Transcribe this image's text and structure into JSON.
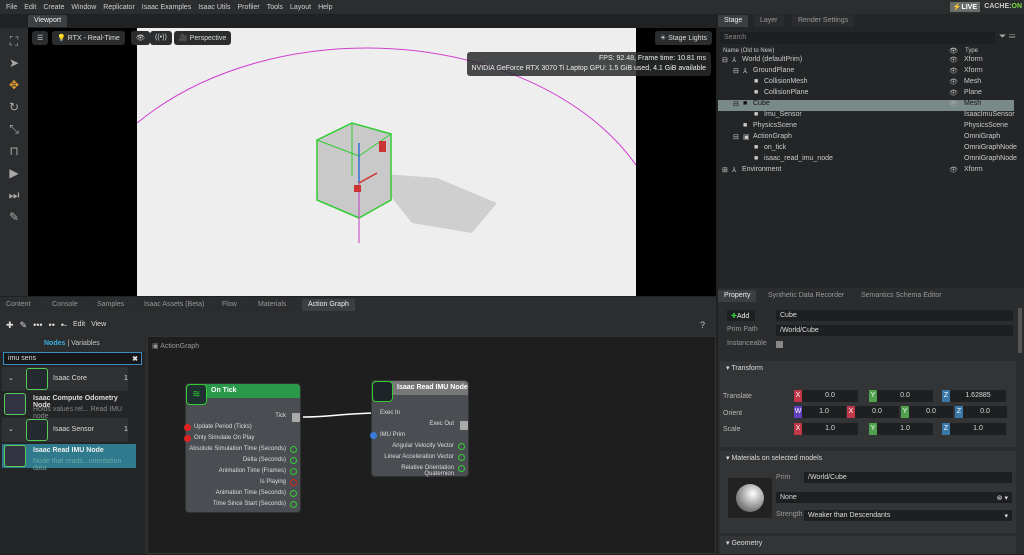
{
  "menu": [
    "File",
    "Edit",
    "Create",
    "Window",
    "Replicator",
    "Isaac Examples",
    "Isaac Utils",
    "Profiler",
    "Tools",
    "Layout",
    "Help"
  ],
  "status": {
    "live": "LIVE",
    "cache_label": "CACHE:",
    "cache_value": "ON"
  },
  "viewport": {
    "tab": "Viewport",
    "renderer": "RTX - Real-Time",
    "camera": "Perspective",
    "lights": "Stage Lights",
    "fps": "FPS: 92.48, Frame time: 10.81 ms",
    "gpu": "NVIDIA GeForce RTX 3070 Ti Laptop GPU: 1.5 GiB used, 4.1 GiB available"
  },
  "bottom_tabs": [
    "Content",
    "Console",
    "Samples",
    "Isaac Assets (Beta)",
    "Flow",
    "Materials",
    "Action Graph"
  ],
  "graph_toolbar": {
    "edit": "Edit",
    "view": "View",
    "help": "?"
  },
  "library": {
    "tab_nodes": "Nodes",
    "tab_variables": "Variables",
    "search": "imu sens",
    "categories": [
      {
        "name": "Isaac Core",
        "count": "1",
        "nodes": [
          {
            "title": "Isaac Compute Odometry Node",
            "desc": "Holds values rel... Read IMU node"
          }
        ]
      },
      {
        "name": "Isaac Sensor",
        "count": "1",
        "nodes": [
          {
            "title": "Isaac Read IMU Node",
            "desc": "Node that reads...orientation data"
          }
        ]
      }
    ]
  },
  "graph": {
    "breadcrumb": "ActionGraph",
    "on_tick": {
      "title": "On Tick",
      "outputs": [
        "Tick"
      ],
      "inputs": [
        "Update Period (Ticks)",
        "Only Simulate On Play"
      ],
      "values": [
        "Absolute Simulation Time (Seconds)",
        "Delta (Seconds)",
        "Animation Time (Frames)",
        "Is Playing",
        "Animation Time (Seconds)",
        "Time Since Start (Seconds)"
      ]
    },
    "imu": {
      "title": "Isaac Read IMU Node",
      "exec_in": "Exec In",
      "exec_out": "Exec Out",
      "prim": "IMU Prim",
      "values": [
        "Angular Velocity Vector",
        "Linear Acceleration Vector",
        "Relative Orientation Quaternion"
      ]
    }
  },
  "stage": {
    "tabs": [
      "Stage",
      "Layer",
      "Render Settings"
    ],
    "search_placeholder": "Search",
    "col_name": "Name (Old to New)",
    "col_type": "Type",
    "rows": [
      {
        "name": "World (defaultPrim)",
        "type": "Xform"
      },
      {
        "name": "GroundPlane",
        "type": "Xform"
      },
      {
        "name": "CollisionMesh",
        "type": "Mesh"
      },
      {
        "name": "CollisionPlane",
        "type": "Plane"
      },
      {
        "name": "Cube",
        "type": "Mesh"
      },
      {
        "name": "Imu_Sensor",
        "type": "IsaacImuSensor"
      },
      {
        "name": "PhysicsScene",
        "type": "PhysicsScene"
      },
      {
        "name": "ActionGraph",
        "type": "OmniGraph"
      },
      {
        "name": "on_tick",
        "type": "OmniGraphNode"
      },
      {
        "name": "isaac_read_imu_node",
        "type": "OmniGraphNode"
      },
      {
        "name": "Environment",
        "type": "Xform"
      }
    ]
  },
  "property": {
    "tabs": [
      "Property",
      "Synthetic Data Recorder",
      "Semantics Schema Editor"
    ],
    "add": "Add",
    "name": "Cube",
    "prim_path_label": "Prim Path",
    "prim_path": "/World/Cube",
    "instanceable": "Instanceable",
    "transform": "Transform",
    "translate_label": "Translate",
    "orient_label": "Orient",
    "scale_label": "Scale",
    "translate": [
      "0.0",
      "0.0",
      "1.62885"
    ],
    "orient": [
      "1.0",
      "0.0",
      "0.0",
      "0.0"
    ],
    "scale": [
      "1.0",
      "1.0",
      "1.0"
    ],
    "materials": "Materials on selected models",
    "prim_label": "Prim",
    "prim": "/World/Cube",
    "material": "None",
    "strength_label": "Strength",
    "strength": "Weaker than Descendants",
    "geometry": "Geometry"
  }
}
